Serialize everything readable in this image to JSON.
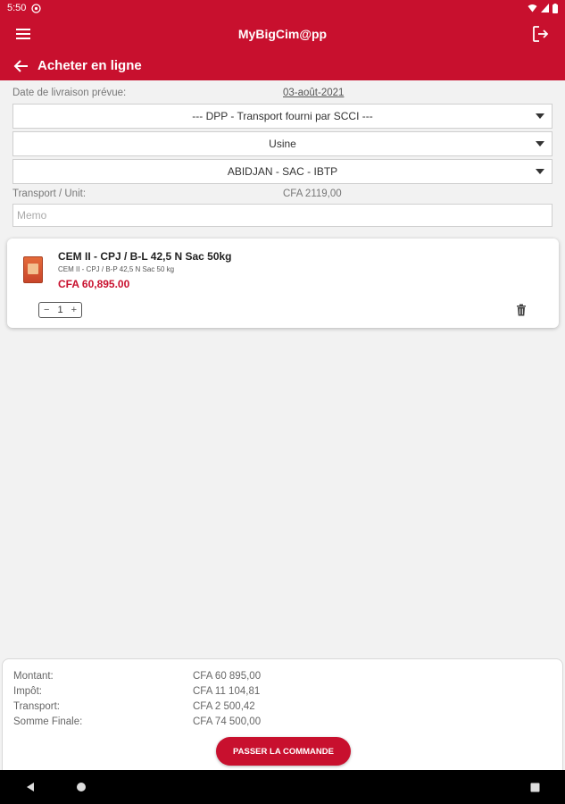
{
  "status_bar": {
    "time": "5:50"
  },
  "app_bar": {
    "title": "MyBigCim@pp"
  },
  "sub_bar": {
    "title": "Acheter en ligne"
  },
  "form": {
    "delivery_label": "Date de livraison prévue:",
    "delivery_date": "03-août-2021",
    "transport_select": "--- DPP - Transport fourni par SCCI ---",
    "site_select": "Usine",
    "location_select": "ABIDJAN - SAC - IBTP",
    "transport_unit_label": "Transport / Unit:",
    "transport_unit_value": "CFA  2119,00",
    "memo_placeholder": "Memo"
  },
  "cart": {
    "items": [
      {
        "name": "CEM II - CPJ / B-L 42,5 N Sac 50kg",
        "description": "CEM II - CPJ / B-P 42,5 N Sac 50 kg",
        "price": "CFA  60,895.00",
        "quantity": "1",
        "minus": "−",
        "plus": "+"
      }
    ]
  },
  "summary": {
    "montant_label": "Montant:",
    "montant_value": "CFA  60 895,00",
    "impot_label": "Impôt:",
    "impot_value": "CFA  11 104,81",
    "transport_label": "Transport:",
    "transport_value": "CFA  2 500,42",
    "somme_label": "Somme Finale:",
    "somme_value": "CFA  74 500,00",
    "order_button": "PASSER LA COMMANDE"
  },
  "icons": {
    "menu": "hamburger-menu-icon",
    "logout": "logout-icon",
    "back": "back-arrow-icon",
    "dropdown": "dropdown-caret-icon",
    "delete": "trash-icon"
  },
  "colors": {
    "brand_red": "#c8102e",
    "background": "#f2f2f2"
  }
}
